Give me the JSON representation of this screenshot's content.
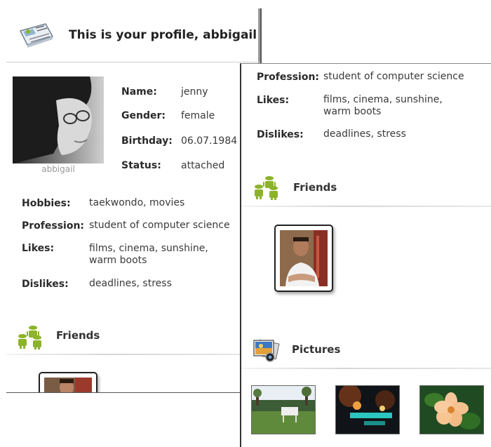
{
  "header": {
    "title": "This is your profile, abbigail"
  },
  "profile": {
    "avatar_caption": "abbigail",
    "name_label": "Name:",
    "name": "jenny",
    "gender_label": "Gender:",
    "gender": "female",
    "birthday_label": "Birthday:",
    "birthday": "06.07.1984",
    "status_label": "Status:",
    "status": "attached",
    "hobbies_label": "Hobbies:",
    "hobbies": "taekwondo, movies",
    "profession_label": "Profession:",
    "profession": "student of computer science",
    "likes_label": "Likes:",
    "likes_line1": "films, cinema, sunshine,",
    "likes_line2": "warm boots",
    "dislikes_label": "Dislikes:",
    "dislikes": "deadlines, stress"
  },
  "friends": {
    "title": "Friends"
  },
  "pictures": {
    "title": "Pictures"
  },
  "colors": {
    "android_green": "#8cb32b",
    "divider": "#d6d6d6"
  },
  "icons": [
    "newspaper-profile-icon",
    "android-friends-icon",
    "pictures-icon"
  ]
}
